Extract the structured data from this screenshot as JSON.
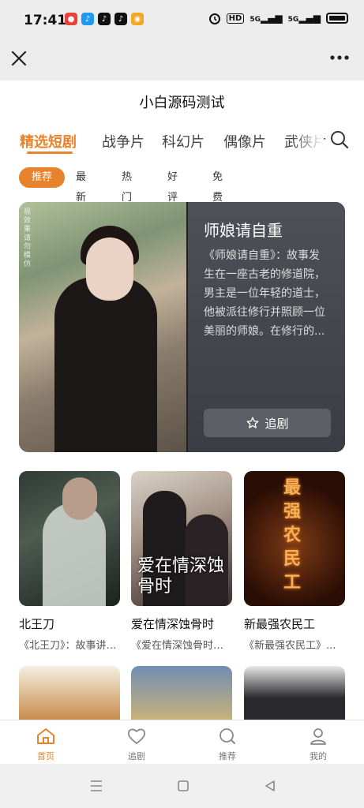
{
  "status_bar": {
    "time": "17:41",
    "app_icons": [
      {
        "name": "weibo-red-icon",
        "color": "#e8433a",
        "glyph": "●"
      },
      {
        "name": "qq-icon",
        "color": "#1e9bf0",
        "glyph": "♪"
      },
      {
        "name": "tiktok-icon",
        "color": "#111111",
        "glyph": "♪"
      },
      {
        "name": "tiktok-lite-icon",
        "color": "#111111",
        "glyph": "♪"
      },
      {
        "name": "weibo-icon",
        "color": "#f5a623",
        "glyph": "◉"
      }
    ],
    "hd_label": "HD",
    "signal1": "5G",
    "signal2": "5G"
  },
  "page": {
    "title": "小白源码测试"
  },
  "category_tabs": [
    {
      "label": "精选短剧",
      "active": true
    },
    {
      "label": "战争片",
      "active": false
    },
    {
      "label": "科幻片",
      "active": false
    },
    {
      "label": "偶像片",
      "active": false
    },
    {
      "label": "武侠片",
      "active": false
    }
  ],
  "filter_chips": [
    {
      "label": "推荐",
      "active": true
    },
    {
      "label": "最新",
      "active": false
    },
    {
      "label": "热门",
      "active": false
    },
    {
      "label": "好评",
      "active": false
    },
    {
      "label": "免费",
      "active": false
    }
  ],
  "featured": {
    "title": "师娘请自重",
    "description": "《师娘请自重》：故事发生在一座古老的修道院，男主是一位年轻的道士，他被派往修行并照顾一位美丽的师娘。在修行的...",
    "watermark": "视效果请勿模仿",
    "follow_label": "追剧"
  },
  "cards": [
    {
      "title": "北王刀",
      "desc": "《北王刀》：故事讲述..."
    },
    {
      "title": "爱在情深蚀骨时",
      "desc": "《爱在情深蚀骨时》...",
      "poster_text": "爱在情深蚀骨时"
    },
    {
      "title": "新最强农民工",
      "desc": "《新最强农民工》...",
      "poster_text": "最强农民工"
    }
  ],
  "bottom_tabs": [
    {
      "label": "首页",
      "icon": "home-icon",
      "active": true
    },
    {
      "label": "追剧",
      "icon": "heart-icon",
      "active": false
    },
    {
      "label": "推荐",
      "icon": "search-icon",
      "active": false
    },
    {
      "label": "我的",
      "icon": "profile-icon",
      "active": false
    }
  ],
  "colors": {
    "accent": "#e8832b",
    "featured_panel": "#4a4b52"
  }
}
